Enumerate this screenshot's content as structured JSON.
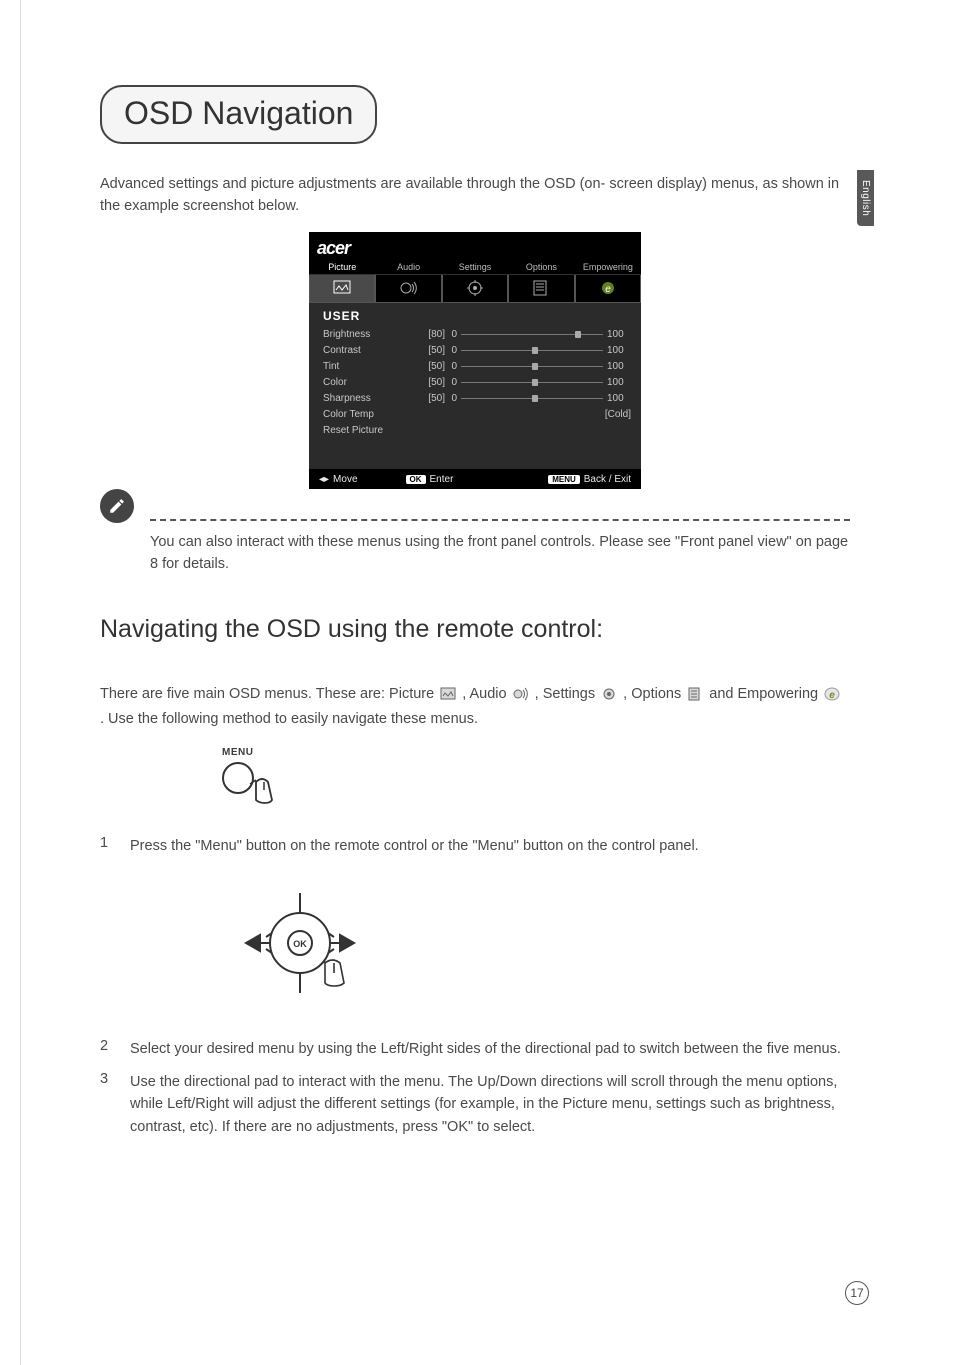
{
  "lang_tab": "English",
  "page_title": "OSD Navigation",
  "intro": "Advanced settings and picture adjustments are available through the OSD (on- screen display) menus, as shown in the example screenshot below.",
  "osd": {
    "brand": "acer",
    "tabs": [
      "Picture",
      "Audio",
      "Settings",
      "Options",
      "Empowering"
    ],
    "section": "USER",
    "rows": [
      {
        "label": "Brightness",
        "val": "[80]",
        "min": "0",
        "max": "100",
        "pct": 80
      },
      {
        "label": "Contrast",
        "val": "[50]",
        "min": "0",
        "max": "100",
        "pct": 50
      },
      {
        "label": "Tint",
        "val": "[50]",
        "min": "0",
        "max": "100",
        "pct": 50
      },
      {
        "label": "Color",
        "val": "[50]",
        "min": "0",
        "max": "100",
        "pct": 50
      },
      {
        "label": "Sharpness",
        "val": "[50]",
        "min": "0",
        "max": "100",
        "pct": 50
      }
    ],
    "static_rows": [
      {
        "label": "Color Temp",
        "right": "[Cold]"
      },
      {
        "label": "Reset Picture",
        "right": ""
      }
    ],
    "footer": {
      "move": "Move",
      "ok": "OK",
      "enter": "Enter",
      "menu": "MENU",
      "back": "Back / Exit"
    }
  },
  "note": "You can also interact with these menus using the front panel controls. Please see \"Front panel view\" on page 8 for details.",
  "subheading": "Navigating the OSD using the remote control:",
  "menus_line_pre": "There are five main OSD menus. These are: Picture ",
  "menus_line_mid1": ", Audio ",
  "menus_line_mid2": ", Settings ",
  "menus_line_mid3": ", Options ",
  "menus_line_mid4": " and Empowering ",
  "menus_line_end": " . Use the following method to easily navigate these menus.",
  "menu_label": "MENU",
  "steps": {
    "s1": "Press the \"Menu\" button on the remote control or the \"Menu\" button on the control panel.",
    "s2": "Select your desired menu by using the Left/Right sides of the directional pad to switch between the five menus.",
    "s3": "Use the directional pad to interact with the menu. The Up/Down directions will scroll through the menu options, while Left/Right will adjust the different settings (for example, in the Picture menu, settings such as brightness, contrast, etc). If there are no adjustments, press \"OK\" to select."
  },
  "page_number": "17"
}
